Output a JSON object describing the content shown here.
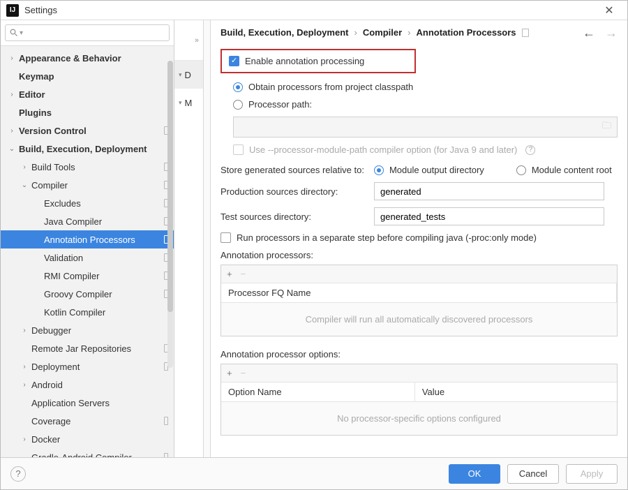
{
  "window": {
    "title": "Settings"
  },
  "sidebar": {
    "search_placeholder": "",
    "items": [
      {
        "label": "Appearance & Behavior",
        "depth": 0,
        "expandable": true,
        "expanded": false,
        "bold": true,
        "marker": false
      },
      {
        "label": "Keymap",
        "depth": 0,
        "expandable": false,
        "bold": true,
        "marker": false
      },
      {
        "label": "Editor",
        "depth": 0,
        "expandable": true,
        "expanded": false,
        "bold": true,
        "marker": false
      },
      {
        "label": "Plugins",
        "depth": 0,
        "expandable": false,
        "bold": true,
        "marker": false
      },
      {
        "label": "Version Control",
        "depth": 0,
        "expandable": true,
        "expanded": false,
        "bold": true,
        "marker": true
      },
      {
        "label": "Build, Execution, Deployment",
        "depth": 0,
        "expandable": true,
        "expanded": true,
        "bold": true,
        "marker": false
      },
      {
        "label": "Build Tools",
        "depth": 1,
        "expandable": true,
        "expanded": false,
        "bold": false,
        "marker": true
      },
      {
        "label": "Compiler",
        "depth": 1,
        "expandable": true,
        "expanded": true,
        "bold": false,
        "marker": true
      },
      {
        "label": "Excludes",
        "depth": 2,
        "expandable": false,
        "bold": false,
        "marker": true
      },
      {
        "label": "Java Compiler",
        "depth": 2,
        "expandable": false,
        "bold": false,
        "marker": true
      },
      {
        "label": "Annotation Processors",
        "depth": 2,
        "expandable": false,
        "bold": false,
        "marker": true,
        "selected": true
      },
      {
        "label": "Validation",
        "depth": 2,
        "expandable": false,
        "bold": false,
        "marker": true
      },
      {
        "label": "RMI Compiler",
        "depth": 2,
        "expandable": false,
        "bold": false,
        "marker": true
      },
      {
        "label": "Groovy Compiler",
        "depth": 2,
        "expandable": false,
        "bold": false,
        "marker": true
      },
      {
        "label": "Kotlin Compiler",
        "depth": 2,
        "expandable": false,
        "bold": false,
        "marker": false
      },
      {
        "label": "Debugger",
        "depth": 1,
        "expandable": true,
        "expanded": false,
        "bold": false,
        "marker": false
      },
      {
        "label": "Remote Jar Repositories",
        "depth": 1,
        "expandable": false,
        "bold": false,
        "marker": true
      },
      {
        "label": "Deployment",
        "depth": 1,
        "expandable": true,
        "expanded": false,
        "bold": false,
        "marker": true
      },
      {
        "label": "Android",
        "depth": 1,
        "expandable": true,
        "expanded": false,
        "bold": false,
        "marker": false
      },
      {
        "label": "Application Servers",
        "depth": 1,
        "expandable": false,
        "bold": false,
        "marker": false
      },
      {
        "label": "Coverage",
        "depth": 1,
        "expandable": false,
        "bold": false,
        "marker": true
      },
      {
        "label": "Docker",
        "depth": 1,
        "expandable": true,
        "expanded": false,
        "bold": false,
        "marker": false
      },
      {
        "label": "Gradle-Android Compiler",
        "depth": 1,
        "expandable": false,
        "bold": false,
        "marker": true
      }
    ]
  },
  "profiles": {
    "more": "»",
    "rows": [
      {
        "label": "D",
        "selected": true,
        "chev": "▾"
      },
      {
        "label": "M",
        "selected": false,
        "chev": "▾"
      }
    ]
  },
  "breadcrumb": {
    "parts": [
      "Build, Execution, Deployment",
      "Compiler",
      "Annotation Processors"
    ]
  },
  "form": {
    "enable_label": "Enable annotation processing",
    "enable_checked": true,
    "obtain_label": "Obtain processors from project classpath",
    "obtain_checked": true,
    "ppath_label": "Processor path:",
    "ppath_checked": false,
    "module_path_label": "Use --processor-module-path compiler option (for Java 9 and later)",
    "store_label": "Store generated sources relative to:",
    "store_opt1": "Module output directory",
    "store_opt1_checked": true,
    "store_opt2": "Module content root",
    "store_opt2_checked": false,
    "prod_label": "Production sources directory:",
    "prod_value": "generated",
    "test_label": "Test sources directory:",
    "test_value": "generated_tests",
    "separate_label": "Run processors in a separate step before compiling java (-proc:only mode)",
    "separate_checked": false,
    "processors_section": "Annotation processors:",
    "processors_header": "Processor FQ Name",
    "processors_empty": "Compiler will run all automatically discovered processors",
    "options_section": "Annotation processor options:",
    "options_header_name": "Option Name",
    "options_header_value": "Value",
    "options_empty": "No processor-specific options configured"
  },
  "footer": {
    "ok": "OK",
    "cancel": "Cancel",
    "apply": "Apply"
  }
}
